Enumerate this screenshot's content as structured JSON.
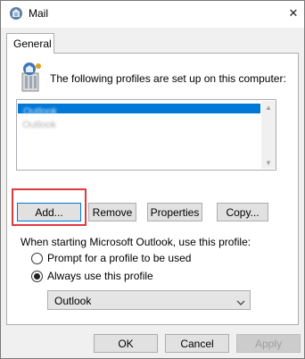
{
  "window": {
    "title": "Mail",
    "close_glyph": "✕"
  },
  "tabs": [
    {
      "label": "General",
      "active": true
    }
  ],
  "profiles": {
    "intro": "The following profiles are set up on this computer:",
    "list": [
      {
        "name": "Outlook",
        "selected": true
      },
      {
        "name": "Outlook",
        "selected": false
      }
    ],
    "scroll_up_glyph": "▲",
    "scroll_down_glyph": "▼"
  },
  "buttons": {
    "add": "Add...",
    "remove": "Remove",
    "properties": "Properties",
    "copy": "Copy..."
  },
  "startup": {
    "label": "When starting Microsoft Outlook, use this profile:",
    "options": [
      {
        "label": "Prompt for a profile to be used",
        "selected": false
      },
      {
        "label": "Always use this profile",
        "selected": true
      }
    ],
    "selected_profile": "Outlook"
  },
  "footer": {
    "ok": "OK",
    "cancel": "Cancel",
    "apply": "Apply"
  },
  "colors": {
    "selection": "#0078d7",
    "highlight": "#e03a3e",
    "focus": "#0078d7"
  }
}
